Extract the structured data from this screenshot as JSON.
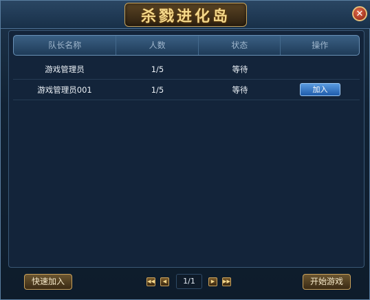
{
  "window": {
    "title": "杀戮进化岛",
    "close_label": "✕"
  },
  "table": {
    "headers": [
      "队长名称",
      "人数",
      "状态",
      "操作"
    ],
    "rows": [
      {
        "captain": "游戏管理员",
        "players": "1/5",
        "status": "等待",
        "action": ""
      },
      {
        "captain": "游戏管理员001",
        "players": "1/5",
        "status": "等待",
        "action": "加入"
      }
    ]
  },
  "footer": {
    "quick_join_label": "快速加入",
    "start_game_label": "开始游戏",
    "page_indicator": "1/1",
    "first_icon": "◀◀",
    "prev_icon": "◀",
    "next_icon": "▶",
    "last_icon": "▶▶"
  }
}
